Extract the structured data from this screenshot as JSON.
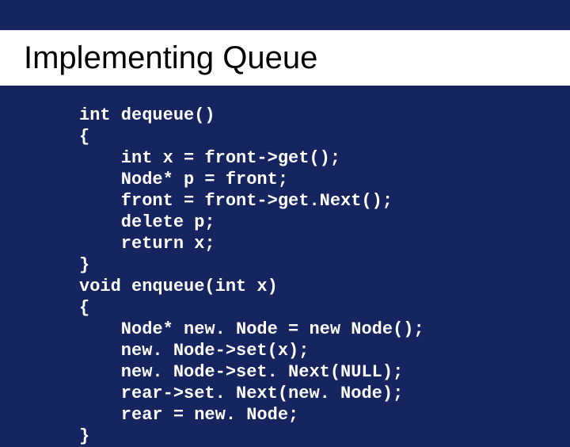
{
  "title": "Implementing Queue",
  "code": {
    "l1": "int dequeue()",
    "l2": "{",
    "l3": "    int x = front->get();",
    "l4": "    Node* p = front;",
    "l5": "    front = front->get.Next();",
    "l6": "    delete p;",
    "l7": "    return x;",
    "l8": "}",
    "l9": "void enqueue(int x)",
    "l10": "{",
    "l11": "    Node* new. Node = new Node();",
    "l12": "    new. Node->set(x);",
    "l13": "    new. Node->set. Next(NULL);",
    "l14": "    rear->set. Next(new. Node);",
    "l15": "    rear = new. Node;",
    "l16": "}"
  }
}
